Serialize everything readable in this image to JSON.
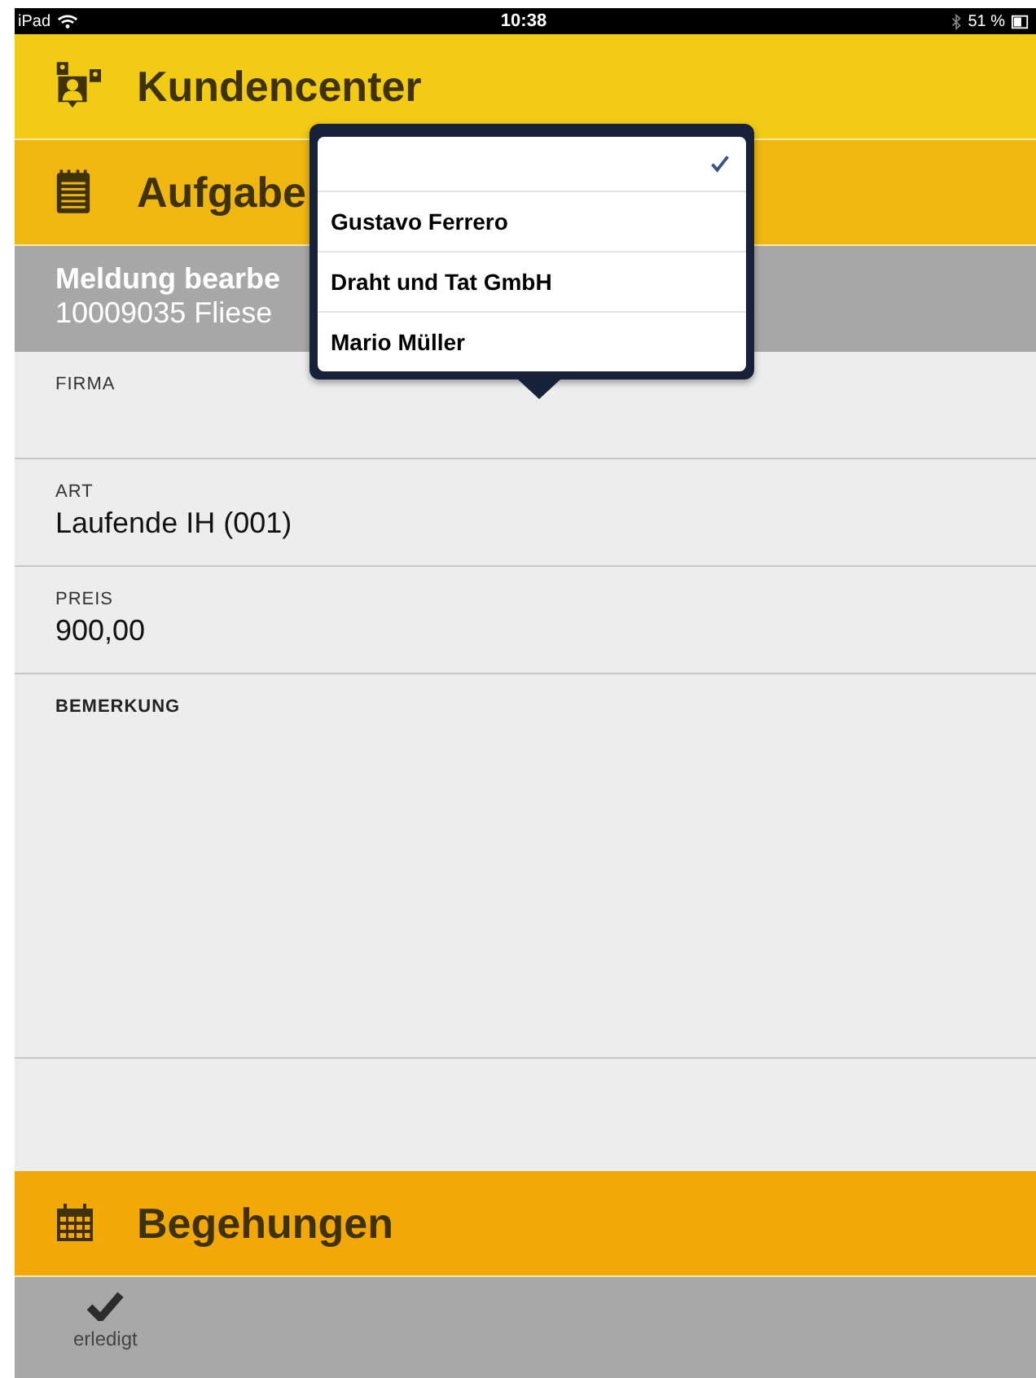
{
  "status_bar": {
    "device": "iPad",
    "time": "10:38",
    "battery": "51 %"
  },
  "sections": [
    {
      "title": "Kundencenter",
      "color": "#f2cb14"
    },
    {
      "title": "Aufgabe",
      "color": "#f0b711"
    }
  ],
  "header": {
    "title": "Meldung bearbe",
    "subtitle": "10009035 Fliese"
  },
  "fields": [
    {
      "label": "FIRMA",
      "kind": "value"
    },
    {
      "label": "ART",
      "value": "Laufende IH (001)",
      "kind": "value"
    },
    {
      "label": "PREIS",
      "value": "900,00",
      "kind": "value"
    },
    {
      "label": "BEMERKUNG",
      "kind": "note"
    }
  ],
  "bottom_section": {
    "title": "Begehungen",
    "color": "#f2a807"
  },
  "toolbar": {
    "buttons": [
      {
        "label": "erledigt"
      }
    ]
  },
  "popover": {
    "options": [
      {
        "selected": true
      },
      {
        "label": "Gustavo Ferrero",
        "selected": false
      },
      {
        "label": "Draht und Tat GmbH",
        "selected": false
      },
      {
        "label": "Mario Müller",
        "selected": false
      }
    ]
  }
}
